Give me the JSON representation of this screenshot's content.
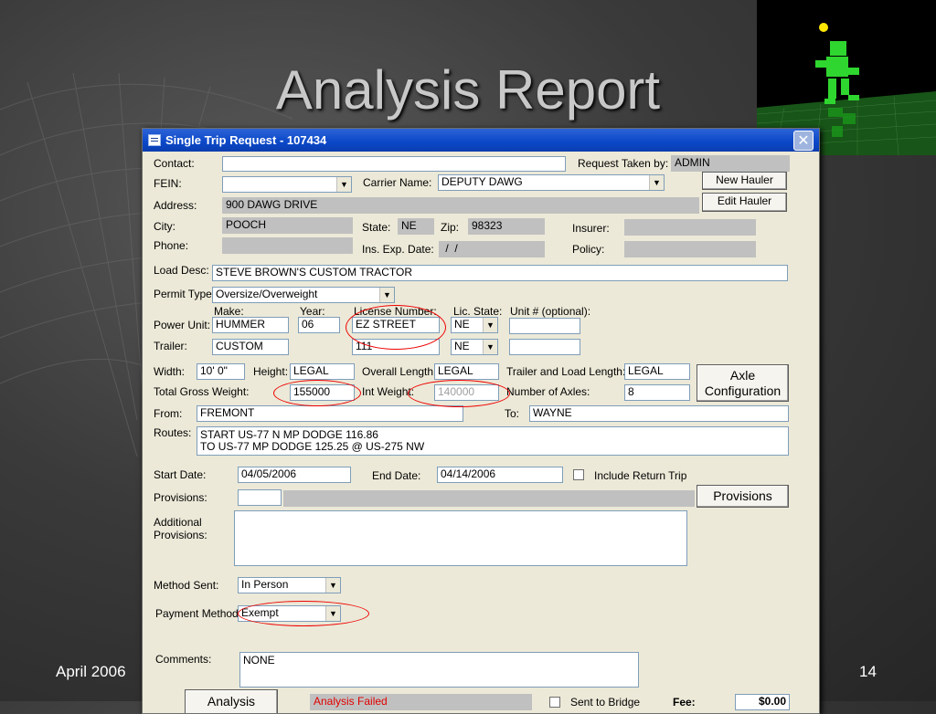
{
  "slide": {
    "title": "Analysis Report",
    "footer_left": "April 2006",
    "footer_right": "14"
  },
  "dialog": {
    "title": "Single Trip Request - 107434",
    "close_glyph": "✕"
  },
  "labels": {
    "contact": "Contact:",
    "request_taken_by": "Request Taken by:",
    "fein": "FEIN:",
    "carrier_name": "Carrier Name:",
    "address": "Address:",
    "city": "City:",
    "state": "State:",
    "zip": "Zip:",
    "insurer": "Insurer:",
    "phone": "Phone:",
    "ins_exp_date": "Ins. Exp. Date:",
    "policy": "Policy:",
    "load_desc": "Load Desc:",
    "permit_type": "Permit Type:",
    "make": "Make:",
    "year": "Year:",
    "license_number": "License Number:",
    "lic_state": "Lic. State:",
    "unit_number": "Unit # (optional):",
    "power_unit": "Power Unit:",
    "trailer": "Trailer:",
    "width": "Width:",
    "height": "Height:",
    "overall_length": "Overall Length:",
    "trailer_load_length": "Trailer and Load Length:",
    "total_gross_weight": "Total Gross Weight:",
    "int_weight": "Int Weight:",
    "number_of_axles": "Number of Axles:",
    "from": "From:",
    "to": "To:",
    "routes": "Routes:",
    "start_date": "Start Date:",
    "end_date": "End Date:",
    "include_return_trip": "Include Return Trip",
    "provisions": "Provisions:",
    "additional_provisions": "Additional\nProvisions:",
    "method_sent": "Method Sent:",
    "payment_method": "Payment Method:",
    "comments": "Comments:",
    "sent_to_bridge": "Sent to Bridge",
    "fee": "Fee:"
  },
  "buttons": {
    "new_hauler": "New Hauler",
    "edit_hauler": "Edit Hauler",
    "axle_configuration": "Axle\nConfiguration",
    "provisions": "Provisions",
    "analysis": "Analysis"
  },
  "values": {
    "contact": "",
    "request_taken_by": "ADMIN",
    "fein": "",
    "carrier_name": "DEPUTY DAWG",
    "address": "900 DAWG DRIVE",
    "city": "POOCH",
    "state": "NE",
    "zip": "98323",
    "insurer": "",
    "phone": "",
    "ins_exp_date": " /  /",
    "policy": "",
    "load_desc": "STEVE BROWN'S CUSTOM TRACTOR",
    "permit_type": "Oversize/Overweight",
    "power_unit_make": "HUMMER",
    "power_unit_year": "06",
    "power_unit_license": "EZ STREET",
    "power_unit_lic_state": "NE",
    "power_unit_unit": "",
    "trailer_make": "CUSTOM",
    "trailer_license": "111",
    "trailer_lic_state": "NE",
    "trailer_unit": "",
    "width": "10' 0\"",
    "height": "LEGAL",
    "overall_length": "LEGAL",
    "trailer_load_length": "LEGAL",
    "total_gross_weight": "155000",
    "int_weight": "140000",
    "number_of_axles": "8",
    "from": "FREMONT",
    "to": "WAYNE",
    "routes": "START US-77 N MP DODGE 116.86\nTO US-77 MP DODGE 125.25 @ US-275 NW",
    "start_date": "04/05/2006",
    "end_date": "04/14/2006",
    "include_return_trip": false,
    "provisions_code": "",
    "provisions_desc": "",
    "additional_provisions": "",
    "method_sent": "In Person",
    "payment_method": "Exempt",
    "comments": "NONE",
    "analysis_status": "Analysis Failed",
    "sent_to_bridge": false,
    "fee": "$0.00"
  },
  "colors": {
    "highlight_circle": "#e00000",
    "titlebar": "#0a47c8",
    "dialog_bg": "#ece9d8"
  }
}
